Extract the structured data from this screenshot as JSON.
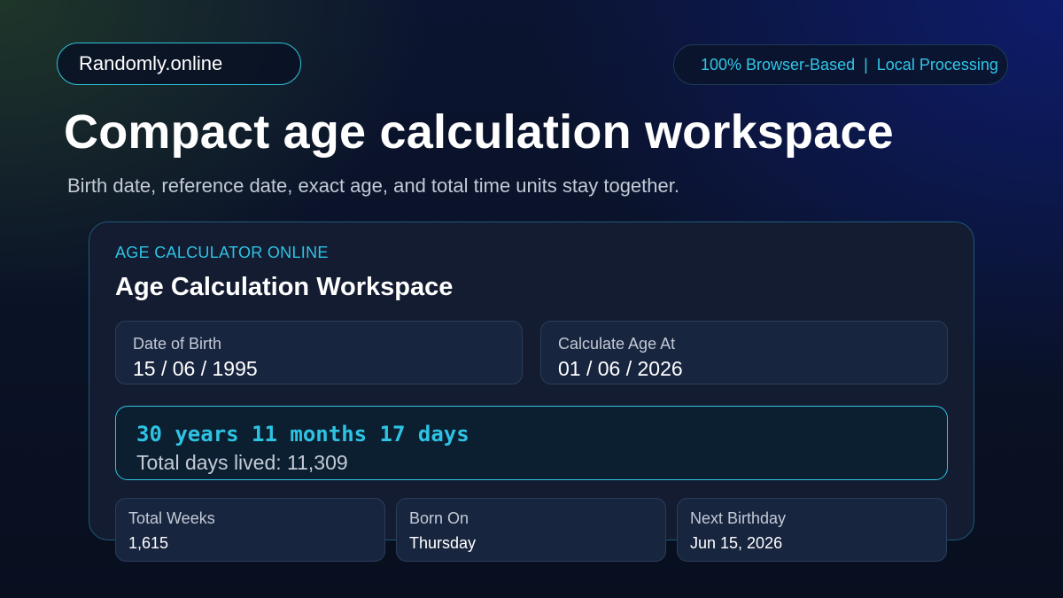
{
  "brand": {
    "name": "Randomly.online"
  },
  "badge": {
    "left": "100% Browser-Based",
    "separator": "|",
    "right": "Local Processing"
  },
  "hero": {
    "title": "Compact age calculation workspace",
    "subtitle": "Birth date, reference date, exact age, and total time units stay together."
  },
  "card": {
    "eyebrow": "AGE CALCULATOR ONLINE",
    "title": "Age Calculation Workspace",
    "birth": {
      "label": "Date of Birth",
      "value": "15 / 06 / 1995"
    },
    "reference": {
      "label": "Calculate Age At",
      "value": "01 / 06 / 2026"
    },
    "result": {
      "age": "30 years 11 months 17 days",
      "total_days": "Total days lived: 11,309"
    },
    "stats": [
      {
        "label": "Total Weeks",
        "value": "1,615"
      },
      {
        "label": "Born On",
        "value": "Thursday"
      },
      {
        "label": "Next Birthday",
        "value": "Jun 15, 2026"
      }
    ]
  },
  "colors": {
    "accent": "#2ec3e3",
    "card_background": "#131c31",
    "field_background": "#18253f",
    "muted_text": "#c3cad6"
  }
}
